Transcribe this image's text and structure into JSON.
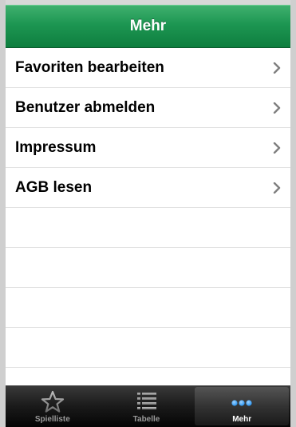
{
  "navbar": {
    "title": "Mehr"
  },
  "list": {
    "items": [
      {
        "label": "Favoriten bearbeiten",
        "icon": "chevron-right-icon"
      },
      {
        "label": "Benutzer abmelden",
        "icon": "chevron-right-icon"
      },
      {
        "label": "Impressum",
        "icon": "chevron-right-icon"
      },
      {
        "label": "AGB lesen",
        "icon": "chevron-right-icon"
      }
    ]
  },
  "tabbar": {
    "tabs": [
      {
        "label": "Spielliste",
        "icon": "star-icon",
        "selected": false
      },
      {
        "label": "Tabelle",
        "icon": "list-icon",
        "selected": false
      },
      {
        "label": "Mehr",
        "icon": "more-dots-icon",
        "selected": true
      }
    ]
  },
  "colors": {
    "navbar_green": "#1d9652",
    "selected_accent": "#1e8ff0",
    "tabbar_dark": "#1a1a1a"
  }
}
